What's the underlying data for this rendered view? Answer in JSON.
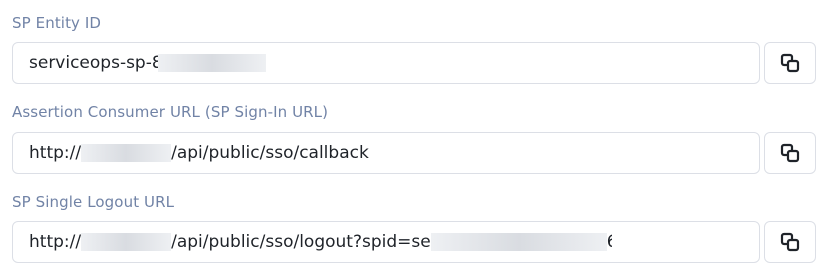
{
  "fields": [
    {
      "label": "SP Entity ID",
      "value_prefix": "serviceops-sp-",
      "value_partial": "8",
      "value_suffix": "",
      "copy_icon": "copy-icon"
    },
    {
      "label": "Assertion Consumer URL (SP Sign-In URL)",
      "value_prefix": "http://",
      "value_suffix": "/api/public/sso/callback",
      "copy_icon": "copy-icon"
    },
    {
      "label": "SP Single Logout URL",
      "value_prefix": "http://",
      "value_suffix": "/api/public/sso/logout?spid=se",
      "value_tail": "6",
      "copy_icon": "copy-icon"
    }
  ]
}
